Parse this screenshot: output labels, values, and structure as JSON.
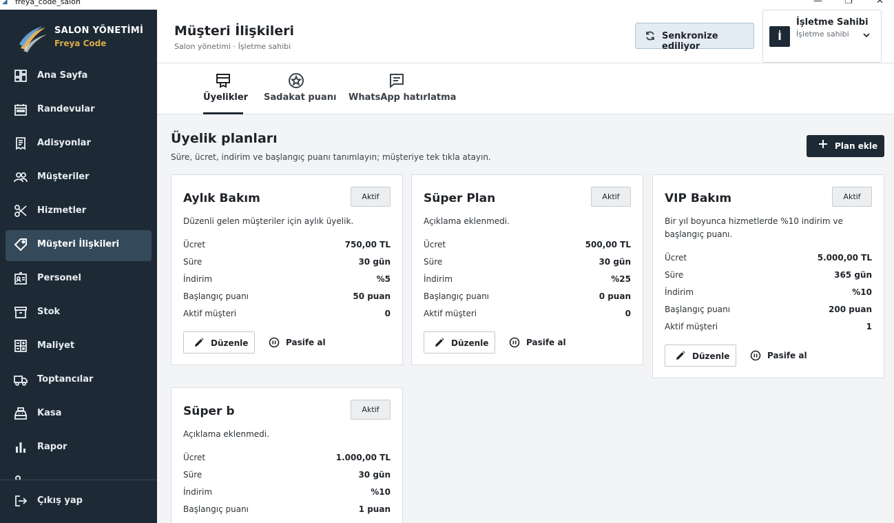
{
  "window": {
    "title": "freya_code_salon"
  },
  "brand": {
    "title": "SALON YÖNETİMİ",
    "subtitle": "Freya Code"
  },
  "sidebar": {
    "items": [
      {
        "label": "Ana Sayfa",
        "icon": "dashboard-icon"
      },
      {
        "label": "Randevular",
        "icon": "calendar-icon"
      },
      {
        "label": "Adisyonlar",
        "icon": "receipt-icon"
      },
      {
        "label": "Müşteriler",
        "icon": "people-icon"
      },
      {
        "label": "Hizmetler",
        "icon": "scissors-icon"
      },
      {
        "label": "Müşteri İlişkileri",
        "icon": "tag-icon",
        "active": true
      },
      {
        "label": "Personel",
        "icon": "id-badge-icon"
      },
      {
        "label": "Stok",
        "icon": "archive-icon"
      },
      {
        "label": "Maliyet",
        "icon": "calculator-icon"
      },
      {
        "label": "Toptancılar",
        "icon": "truck-icon"
      },
      {
        "label": "Kasa",
        "icon": "cash-register-icon"
      },
      {
        "label": "Rapor",
        "icon": "bar-chart-icon"
      }
    ],
    "logout_label": "Çıkış yap"
  },
  "header": {
    "title": "Müşteri İlişkileri",
    "subtitle": "Salon yönetimi · İşletme sahibi",
    "sync_label": "Senkronize ediliyor",
    "user": {
      "initial": "İ",
      "name": "İşletme Sahibi",
      "role": "İşletme sahibi"
    }
  },
  "tabs": [
    {
      "label": "Üyelikler",
      "icon": "membership-icon",
      "active": true
    },
    {
      "label": "Sadakat puanı",
      "icon": "star-badge-icon"
    },
    {
      "label": "WhatsApp hatırlatma",
      "icon": "message-icon"
    }
  ],
  "section": {
    "title": "Üyelik planları",
    "subtitle": "Süre, ücret, indirim ve başlangıç puanı tanımlayın; müşteriye tek tıkla atayın.",
    "add_label": "Plan ekle"
  },
  "row_labels": {
    "price": "Ücret",
    "duration": "Süre",
    "discount": "İndirim",
    "start_points": "Başlangıç puanı",
    "active_customers": "Aktif müşteri"
  },
  "actions": {
    "edit": "Düzenle",
    "deactivate": "Pasife al"
  },
  "plans": [
    {
      "name": "Aylık Bakım",
      "status": "Aktif",
      "description": "Düzenli gelen müşteriler için aylık üyelik.",
      "price": "750,00 TL",
      "duration": "30 gün",
      "discount": "%5",
      "start_points": "50 puan",
      "active_customers": "0"
    },
    {
      "name": "Süper Plan",
      "status": "Aktif",
      "description": "Açıklama eklenmedi.",
      "price": "500,00 TL",
      "duration": "30 gün",
      "discount": "%25",
      "start_points": "0 puan",
      "active_customers": "0"
    },
    {
      "name": "VIP Bakım",
      "status": "Aktif",
      "description": "Bir yıl boyunca hizmetlerde %10 indirim ve başlangıç puanı.",
      "price": "5.000,00 TL",
      "duration": "365 gün",
      "discount": "%10",
      "start_points": "200 puan",
      "active_customers": "1"
    },
    {
      "name": "Süper b",
      "status": "Aktif",
      "description": "Açıklama eklenmedi.",
      "price": "1.000,00 TL",
      "duration": "30 gün",
      "discount": "%10",
      "start_points": "1 puan"
    }
  ]
}
